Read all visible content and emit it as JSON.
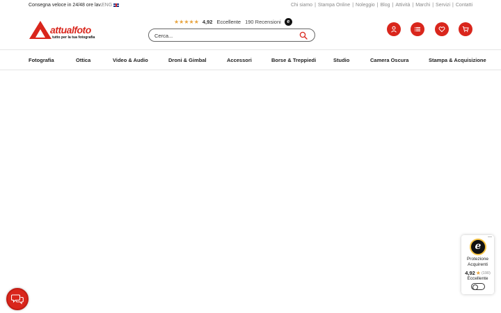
{
  "topbar": {
    "delivery": "Consegna veloce in 24/48 ore lav.",
    "lang": "ENG",
    "links": [
      "Chi siamo",
      "Stampa Online",
      "Noleggio",
      "Blog",
      "Attività",
      "Marchi",
      "Servizi",
      "Contatti"
    ]
  },
  "logo": {
    "name": "attualfoto",
    "tagline": "tutto per la tua fotografia"
  },
  "rating": {
    "stars": "★★★★★",
    "score": "4,92",
    "label": "Eccellente",
    "reviews": "190 Recensioni",
    "badge": "e"
  },
  "search": {
    "placeholder": "Cerca..."
  },
  "icons": [
    "account-icon",
    "list-icon",
    "heart-icon",
    "cart-icon"
  ],
  "nav": {
    "items": [
      "Fotografia",
      "Ottica",
      "Video & Audio",
      "Droni & Gimbal",
      "Accessori",
      "Borse & Treppiedi",
      "Studio",
      "Camera Oscura",
      "Stampa & Acquisizione"
    ]
  },
  "trusted": {
    "close": "—",
    "line1": "Protezione",
    "line2": "Acquirenti",
    "score": "4,92",
    "star": "★",
    "count": "(190)",
    "label": "Eccellente"
  },
  "colors": {
    "brand": "#d9261c",
    "star": "#e8a33d"
  }
}
